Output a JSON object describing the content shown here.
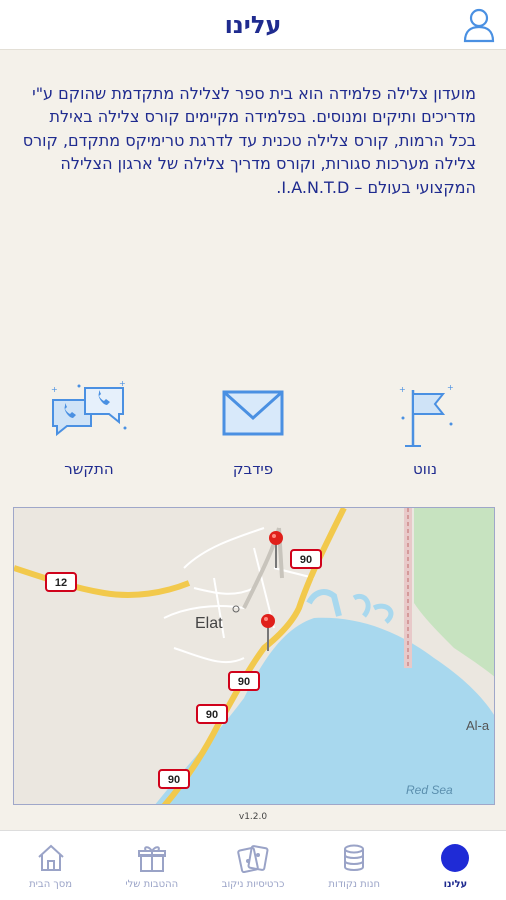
{
  "header": {
    "title": "עלינו"
  },
  "about": {
    "text": "מועדון צלילה פלמידה הוא בית ספר לצלילה מתקדמת שהוקם ע\"י מדריכים ותיקים ומנוסים. בפלמידה מקיימים קורס צלילה באילת בכל הרמות, קורס צלילה טכנית עד לדרגת טרימיקס מתקדם, קורס צלילה מערכות סגורות, וקורס מדריך צלילה של ארגון הצלילה המקצועי בעולם – I.A.N.T.D."
  },
  "actions": [
    {
      "label": "התקשר",
      "icon": "chat-phone-icon"
    },
    {
      "label": "פידבק",
      "icon": "envelope-icon"
    },
    {
      "label": "נווט",
      "icon": "flag-icon"
    }
  ],
  "map": {
    "city_label": "Elat",
    "sea_label": "Red Sea",
    "partial_label": "Al-a",
    "road_shields": [
      "12",
      "90",
      "90",
      "90",
      "90"
    ]
  },
  "version": "v1.2.0",
  "nav": [
    {
      "label": "מסך הבית",
      "icon": "home-icon"
    },
    {
      "label": "ההטבות שלי",
      "icon": "gift-icon"
    },
    {
      "label": "כרטיסיות ניקוב",
      "icon": "punch-cards-icon"
    },
    {
      "label": "חנות נקודות",
      "icon": "coins-icon"
    },
    {
      "label": "עלינו",
      "icon": "about-dot-icon"
    }
  ],
  "colors": {
    "accent": "#1f2b8f",
    "icon_blue": "#4a90e2",
    "background": "#f4f1ea",
    "sea": "#a8d8ee",
    "road_yellow": "#f2c94c"
  }
}
